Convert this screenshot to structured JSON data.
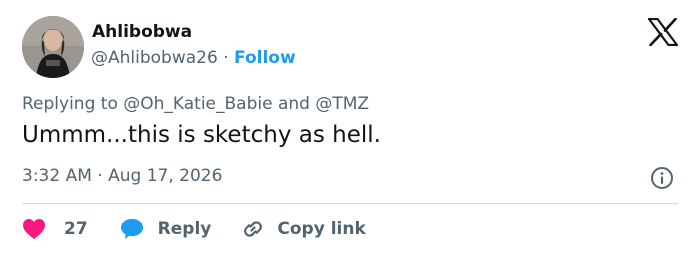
{
  "author": {
    "display_name": "Ahlibobwa",
    "handle": "@Ahlibobwa26",
    "separator": "·",
    "follow_label": "Follow"
  },
  "reply_context": {
    "prefix": "Replying to",
    "mention_1": "@Oh_Katie_Babie",
    "conjunction": "and",
    "mention_2": "@TMZ"
  },
  "tweet": {
    "text": "Ummm...this is sketchy as hell.",
    "time": "3:32 AM",
    "separator": "·",
    "date": "Aug 17, 2026"
  },
  "actions": {
    "like_count": "27",
    "reply_label": "Reply",
    "copy_label": "Copy link"
  },
  "icons": {
    "logo": "x-logo-icon",
    "info": "info-icon",
    "like": "heart-icon",
    "reply": "speech-bubble-icon",
    "copy": "link-icon"
  },
  "colors": {
    "text_primary": "#0f1419",
    "text_secondary": "#536471",
    "link_blue": "#1d9bf0",
    "like_red": "#f91880",
    "divider": "#cfd9de"
  }
}
